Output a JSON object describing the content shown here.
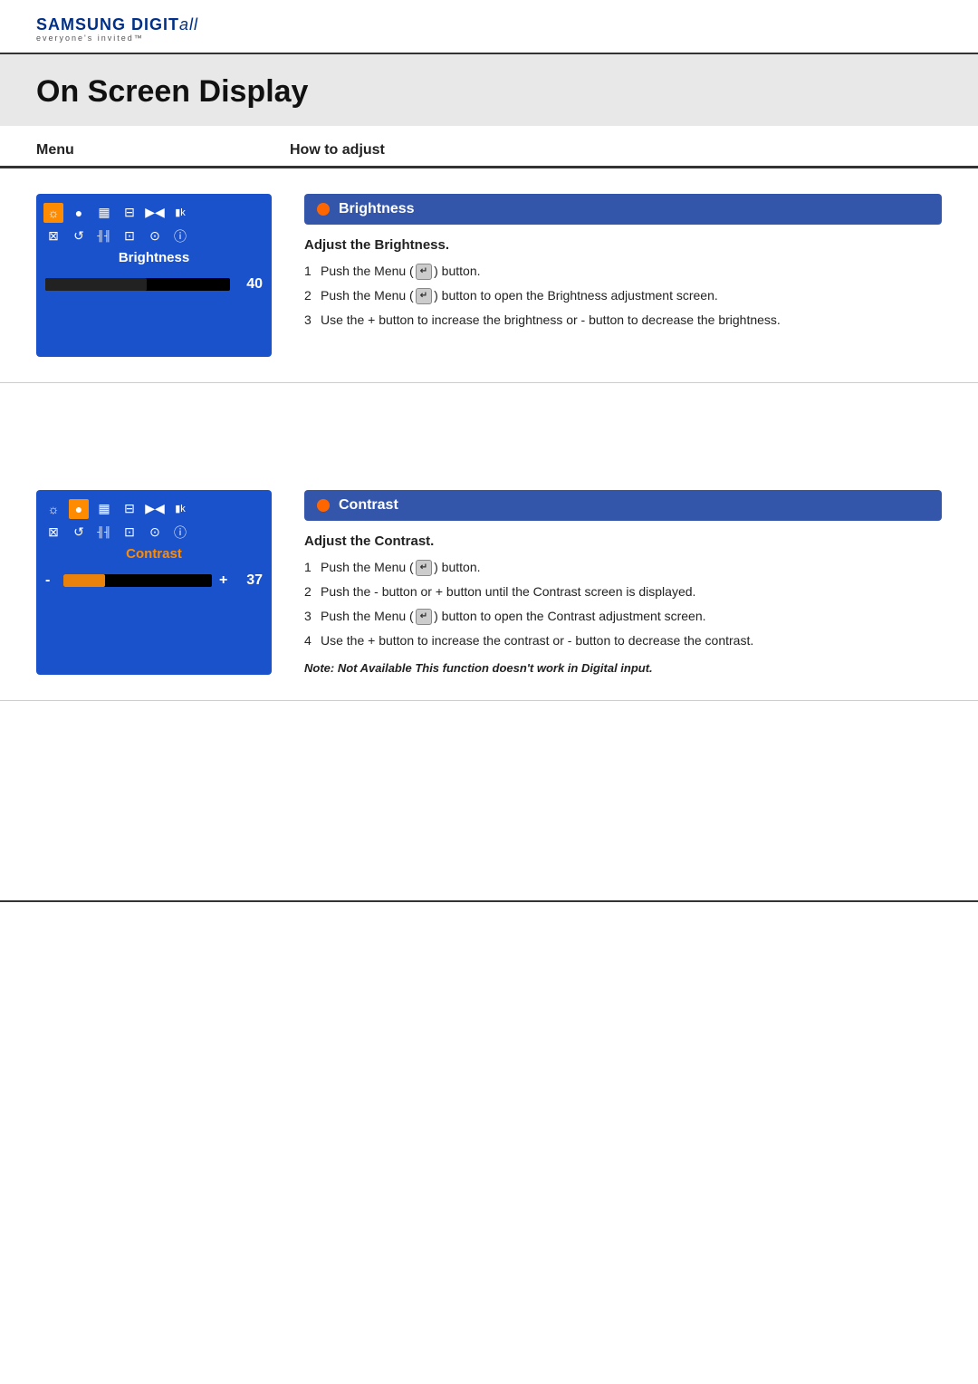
{
  "header": {
    "brand": "SAMSUNG DIGIT",
    "brand_italic": "all",
    "tagline": "everyone's invited™"
  },
  "page": {
    "title": "On Screen Display"
  },
  "columns": {
    "menu": "Menu",
    "how_to_adjust": "How to adjust"
  },
  "brightness_section": {
    "title": "Brightness",
    "osd_label": "Brightness",
    "slider_value": "40",
    "slider_percent": 55,
    "adjust_heading": "Adjust the Brightness.",
    "steps": [
      "Push the Menu (   ) button.",
      "Push the Menu (   ) button to open the Brightness adjustment screen.",
      "Use the + button to increase the brightness or - button to decrease the brightness."
    ]
  },
  "contrast_section": {
    "title": "Contrast",
    "osd_label": "Contrast",
    "slider_value": "37",
    "slider_percent": 28,
    "adjust_heading": "Adjust the Contrast.",
    "steps": [
      "Push the Menu (   ) button.",
      "Push the - button or + button until the Contrast screen is displayed.",
      "Push the Menu (   ) button to open the Contrast adjustment screen.",
      "Use the + button to increase the contrast or - button to decrease the contrast."
    ],
    "note": "Note: Not Available  This function doesn't work in Digital input."
  },
  "osd_icons": {
    "row1": [
      "☼",
      "●",
      "▦",
      "⊟",
      "▶◀",
      "▮k"
    ],
    "row2": [
      "⊠",
      "↺",
      "╢╢",
      "⊡",
      "⊙",
      "ⓘ"
    ]
  }
}
